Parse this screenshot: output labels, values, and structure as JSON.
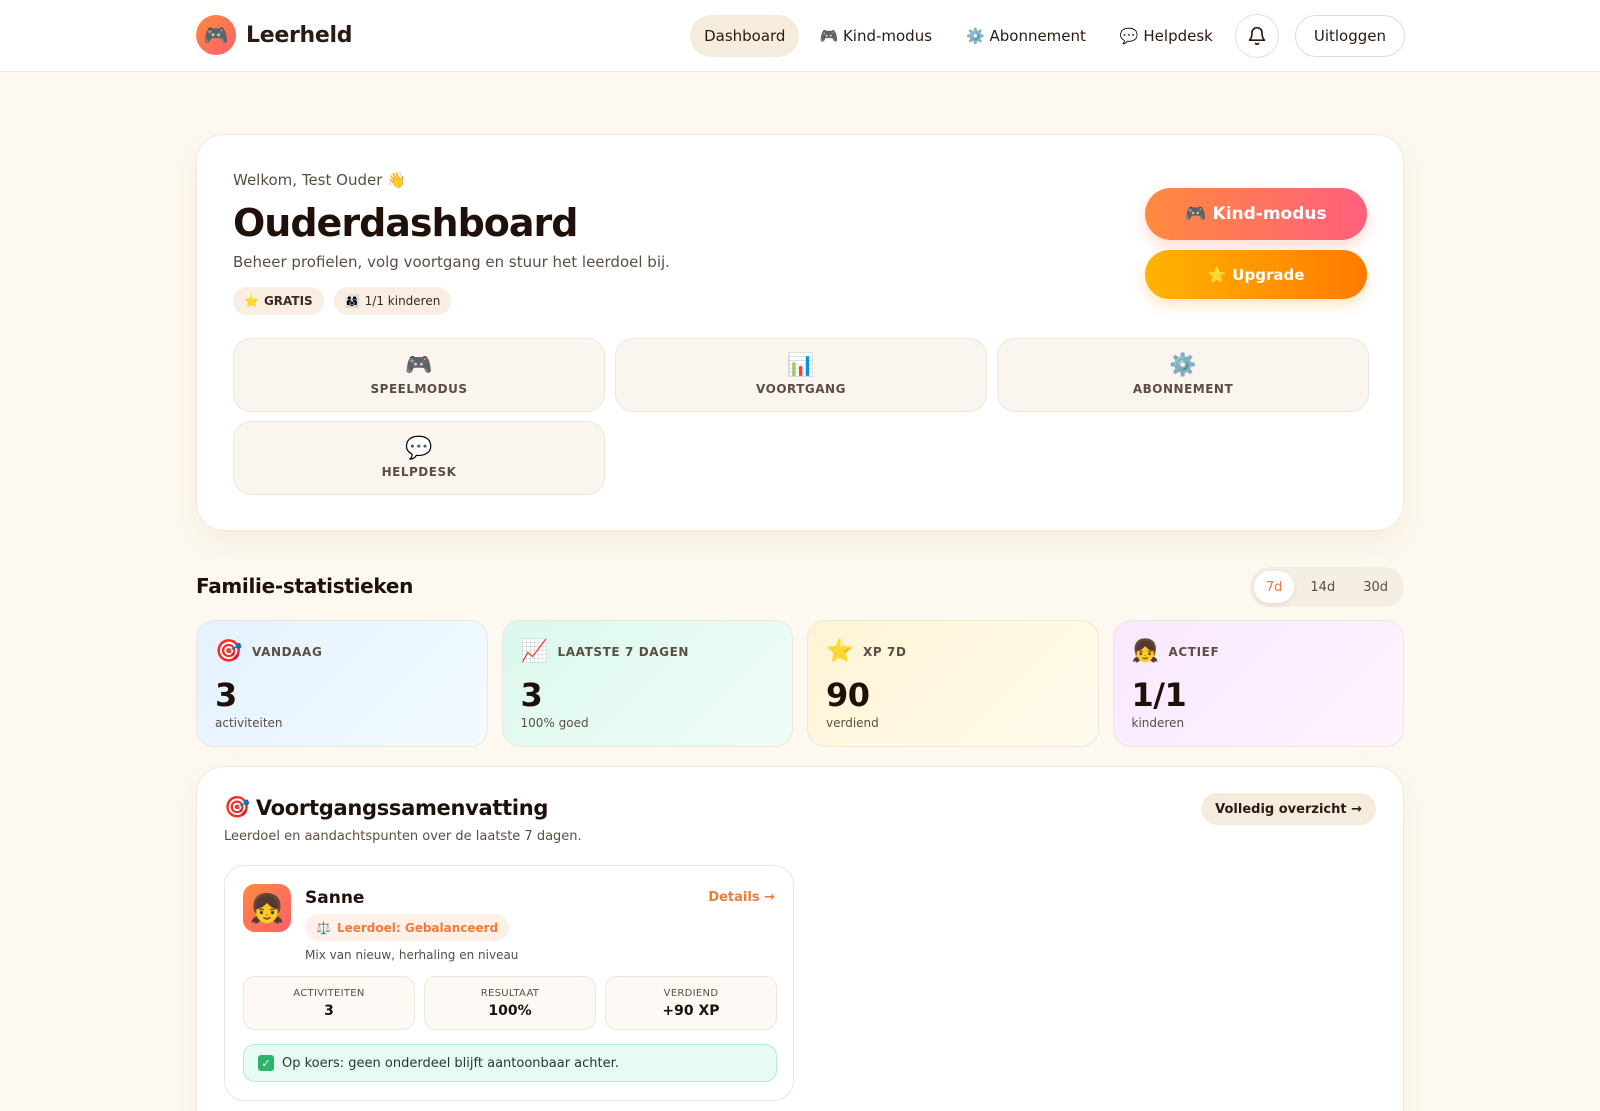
{
  "header": {
    "brand_icon": "🎮",
    "brand_name": "Leerheld",
    "nav": [
      {
        "icon": "",
        "label": "Dashboard"
      },
      {
        "icon": "🎮",
        "label": "Kind-modus"
      },
      {
        "icon": "⚙️",
        "label": "Abonnement"
      },
      {
        "icon": "💬",
        "label": "Helpdesk"
      }
    ],
    "bell_icon": "bell-icon",
    "logout_label": "Uitloggen"
  },
  "hero": {
    "welcome": "Welkom, Test Ouder 👋",
    "title": "Ouderdashboard",
    "subtitle": "Beheer profielen, volg voortgang en stuur het leerdoel bij.",
    "badges": [
      {
        "icon": "⭐",
        "label": "GRATIS"
      },
      {
        "icon": "👨‍👩‍👧",
        "label": "1/1 kinderen"
      }
    ],
    "cta_kind": {
      "icon": "🎮",
      "label": "Kind-modus"
    },
    "cta_upgrade": {
      "icon": "⭐",
      "label": "Upgrade"
    },
    "tiles": [
      {
        "icon": "🎮",
        "label": "SPEELMODUS"
      },
      {
        "icon": "📊",
        "label": "VOORTGANG"
      },
      {
        "icon": "⚙️",
        "label": "ABONNEMENT"
      },
      {
        "icon": "💬",
        "label": "HELPDESK"
      }
    ]
  },
  "stats": {
    "title": "Familie-statistieken",
    "ranges": [
      "7d",
      "14d",
      "30d"
    ],
    "active_range": "7d",
    "cards": [
      {
        "icon": "🎯",
        "label": "VANDAAG",
        "value": "3",
        "sub": "activiteiten"
      },
      {
        "icon": "📈",
        "label": "LAATSTE 7 DAGEN",
        "value": "3",
        "sub": "100% goed"
      },
      {
        "icon": "⭐",
        "label": "XP 7D",
        "value": "90",
        "sub": "verdiend"
      },
      {
        "icon": "👧",
        "label": "ACTIEF",
        "value": "1/1",
        "sub": "kinderen"
      }
    ]
  },
  "summary": {
    "icon": "🎯",
    "title": "Voortgangssamenvatting",
    "subtitle": "Leerdoel en aandachtspunten over de laatste 7 dagen.",
    "link": "Volledig overzicht →",
    "child": {
      "avatar": "👧",
      "name": "Sanne",
      "details_link": "Details →",
      "goal_icon": "⚖️",
      "goal": "Leerdoel: Gebalanceerd",
      "goal_desc": "Mix van nieuw, herhaling en niveau",
      "metrics": [
        {
          "label": "ACTIVITEITEN",
          "value": "3"
        },
        {
          "label": "RESULTAAT",
          "value": "100%"
        },
        {
          "label": "VERDIEND",
          "value": "+90 XP"
        }
      ],
      "status_icon": "✓",
      "status": "Op koers: geen onderdeel blijft aantoonbaar achter."
    }
  }
}
